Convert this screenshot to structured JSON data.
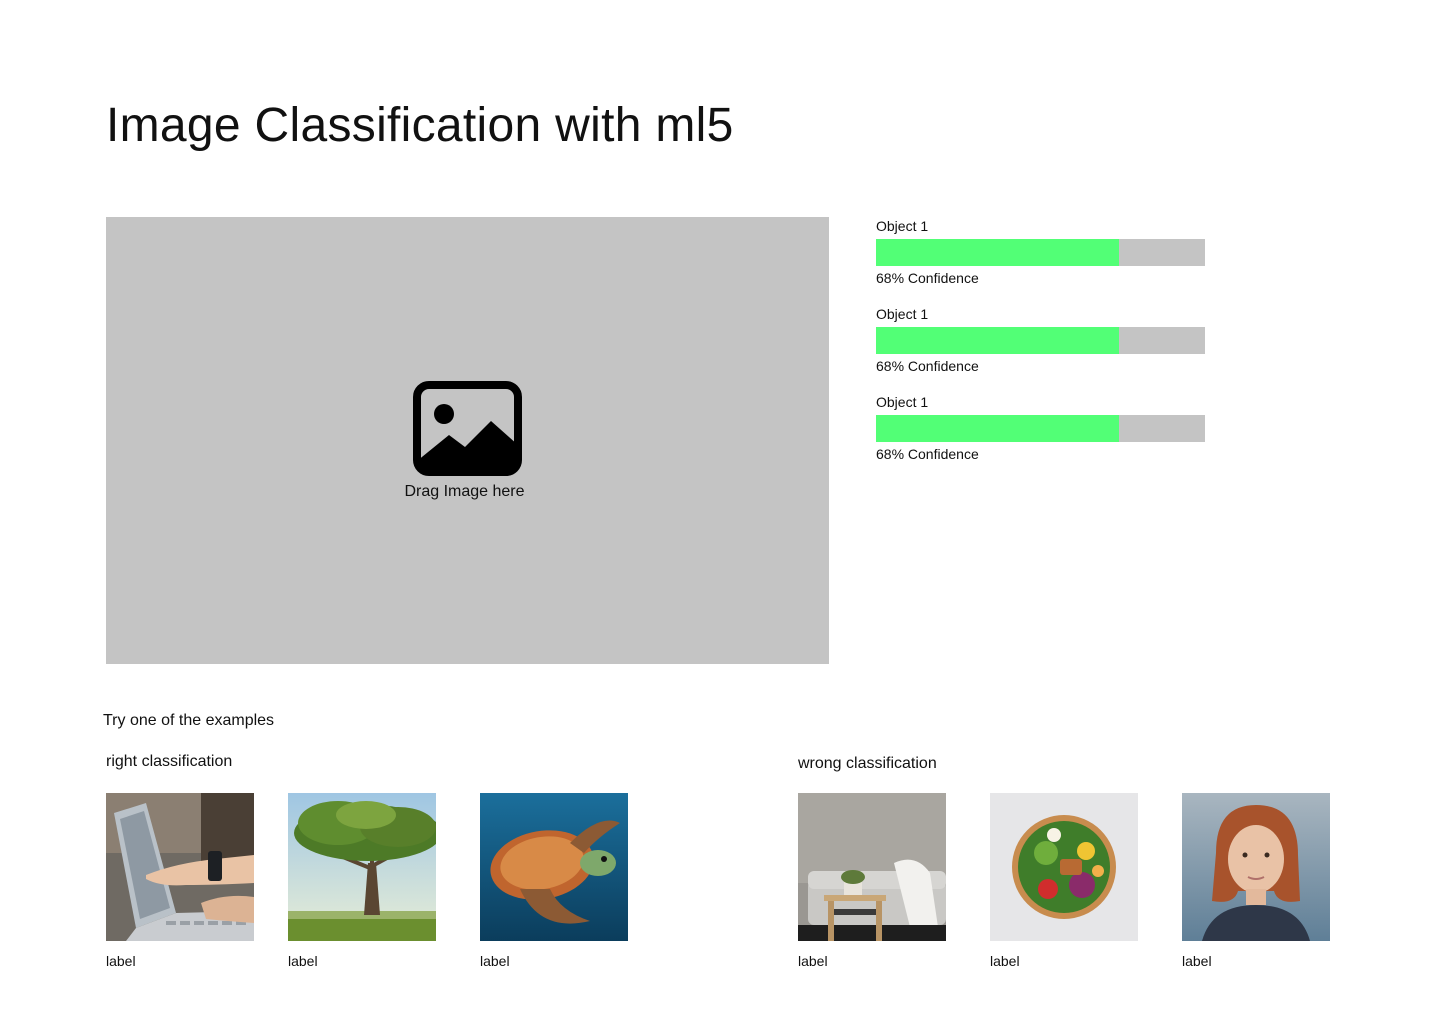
{
  "title": "Image Classification with ml5",
  "dropzone": {
    "label": "Drag Image here",
    "icon": "image-icon"
  },
  "results": [
    {
      "name": "Object 1",
      "confidence_text": "68% Confidence",
      "bar_fill": 0.74
    },
    {
      "name": "Object 1",
      "confidence_text": "68% Confidence",
      "bar_fill": 0.74
    },
    {
      "name": "Object 1",
      "confidence_text": "68% Confidence",
      "bar_fill": 0.74
    }
  ],
  "examples": {
    "title": "Try one of the examples",
    "right": {
      "title": "right classification",
      "items": [
        {
          "label": "label",
          "image": "laptop-hands-photo"
        },
        {
          "label": "label",
          "image": "tree-photo"
        },
        {
          "label": "label",
          "image": "sea-turtle-photo"
        }
      ]
    },
    "wrong": {
      "title": "wrong classification",
      "items": [
        {
          "label": "label",
          "image": "living-room-photo"
        },
        {
          "label": "label",
          "image": "salad-bowl-photo"
        },
        {
          "label": "label",
          "image": "woman-portrait-photo"
        }
      ]
    }
  },
  "colors": {
    "dropzone_bg": "#c4c4c4",
    "bar_track": "#c4c4c4",
    "bar_fill": "#52ff76"
  }
}
